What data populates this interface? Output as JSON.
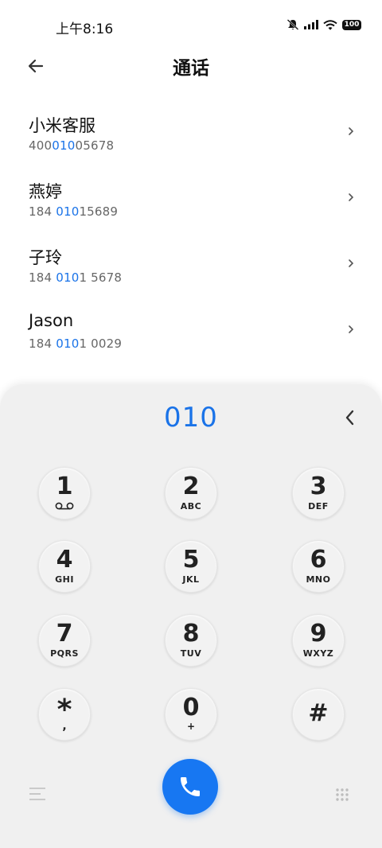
{
  "status_bar": {
    "time": "上午8:16",
    "battery": "100"
  },
  "header": {
    "title": "通话"
  },
  "contacts": [
    {
      "name": "小米客服",
      "number_pre": "400",
      "number_hl": "010",
      "number_post": "05678"
    },
    {
      "name": "燕婷",
      "number_pre": "184 ",
      "number_hl": "010",
      "number_post": "15689"
    },
    {
      "name": "子玲",
      "number_pre": "184 ",
      "number_hl": "010",
      "number_post": "1 5678"
    },
    {
      "name": "Jason",
      "number_pre": "184 ",
      "number_hl": "010",
      "number_post": "1 0029"
    }
  ],
  "dialer": {
    "input": "010",
    "keys": [
      {
        "digit": "1",
        "letters": ""
      },
      {
        "digit": "2",
        "letters": "ABC"
      },
      {
        "digit": "3",
        "letters": "DEF"
      },
      {
        "digit": "4",
        "letters": "GHI"
      },
      {
        "digit": "5",
        "letters": "JKL"
      },
      {
        "digit": "6",
        "letters": "MNO"
      },
      {
        "digit": "7",
        "letters": "PQRS"
      },
      {
        "digit": "8",
        "letters": "TUV"
      },
      {
        "digit": "9",
        "letters": "WXYZ"
      },
      {
        "digit": "*",
        "letters": ","
      },
      {
        "digit": "0",
        "letters": "+"
      },
      {
        "digit": "#",
        "letters": ""
      }
    ]
  },
  "icons": {
    "status": [
      "mute-icon",
      "signal-icon",
      "wifi-icon",
      "battery-icon"
    ],
    "header": "back-arrow-icon",
    "row": "chevron-right-icon",
    "dialer": [
      "backspace-icon",
      "voicemail-icon",
      "phone-icon",
      "menu-icon",
      "keypad-icon"
    ]
  },
  "colors": {
    "accent": "#1a73e8",
    "call_button": "#1777f2"
  }
}
